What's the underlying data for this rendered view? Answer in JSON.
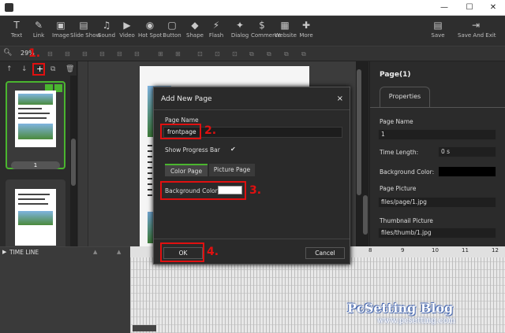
{
  "toolbar": {
    "items": [
      {
        "label": "Text",
        "icon": "T"
      },
      {
        "label": "Link",
        "icon": "✎"
      },
      {
        "label": "Image",
        "icon": "▣"
      },
      {
        "label": "Slide Show",
        "icon": "▤"
      },
      {
        "label": "Sound",
        "icon": "♫"
      },
      {
        "label": "Video",
        "icon": "▶"
      },
      {
        "label": "Hot Spot",
        "icon": "◉"
      },
      {
        "label": "Button",
        "icon": "▢"
      },
      {
        "label": "Shape",
        "icon": "◆"
      },
      {
        "label": "Flash",
        "icon": "⚡"
      },
      {
        "label": "Dialog",
        "icon": "✦"
      },
      {
        "label": "Commerce",
        "icon": "$"
      },
      {
        "label": "Website",
        "icon": "▦"
      },
      {
        "label": "More",
        "icon": "✚"
      }
    ],
    "save": "Save",
    "save_exit": "Save And Exit"
  },
  "zoom": "29%",
  "thumbnail": {
    "page_number": "1"
  },
  "properties": {
    "title": "Page(1)",
    "tab": "Properties",
    "page_name_label": "Page Name",
    "page_name_value": "1",
    "time_length_label": "Time Length:",
    "time_length_value": "0 s",
    "bg_color_label": "Background Color:",
    "page_picture_label": "Page Picture",
    "page_picture_value": "files/page/1.jpg",
    "thumbnail_label": "Thumbnail Picture",
    "thumbnail_value": "files/thumb/1.jpg"
  },
  "timeline": {
    "label": "TIME LINE",
    "ticks": [
      "8",
      "9",
      "10",
      "11",
      "12"
    ]
  },
  "dialog": {
    "title": "Add New Page",
    "close": "×",
    "page_name_label": "Page Name",
    "page_name_value": "frontpage",
    "progress_label": "Show Progress Bar",
    "progress_check": "✔",
    "tab_color": "Color Page",
    "tab_picture": "Picture Page",
    "bg_label": "Background Color",
    "ok": "OK",
    "cancel": "Cancel"
  },
  "annotations": [
    "1.",
    "2.",
    "3.",
    "4."
  ],
  "watermark": {
    "title": "PcSetting Blog",
    "url": "www.pcsetting.com"
  },
  "colors": {
    "highlight": "#e01010",
    "accent_green": "#4ab52f"
  }
}
